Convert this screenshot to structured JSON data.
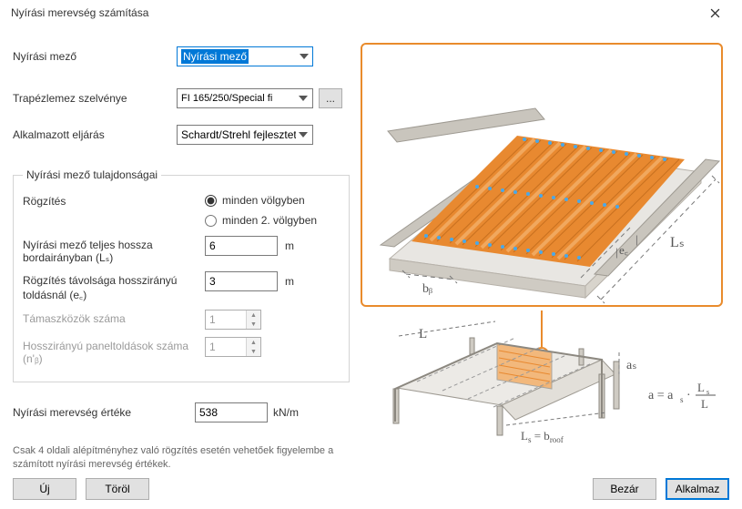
{
  "window": {
    "title": "Nyírási merevség számítása"
  },
  "fields": {
    "shear_field_label": "Nyírási mező",
    "shear_field_value": "Nyírási mező",
    "profile_label": "Trapézlemez szelvénye",
    "profile_value": "FI 165/250/Special fi",
    "ellipsis": "...",
    "method_label": "Alkalmazott eljárás",
    "method_value": "Schardt/Strehl fejlesztett"
  },
  "group": {
    "legend": "Nyírási mező tulajdonságai",
    "fixing_label": "Rögzítés",
    "fixing_opt1": "minden völgyben",
    "fixing_opt2": "minden 2. völgyben",
    "length_label": "Nyírási mező teljes hossza bordairányban (Lₛ)",
    "length_value": "6",
    "length_unit": "m",
    "spacing_label": "Rögzítés távolsága hosszirányú toldásnál (e꜀)",
    "spacing_value": "3",
    "spacing_unit": "m",
    "supports_label": "Támaszközök száma",
    "supports_value": "1",
    "panels_label": "Hosszirányú paneltoldások száma (n'ᵦ)",
    "panels_value": "1"
  },
  "result": {
    "label": "Nyírási merevség értéke",
    "value": "538",
    "unit": "kN/m"
  },
  "note": "Csak 4 oldali alépítményhez való rögzítés esetén vehetőek figyelembe a számított nyírási merevség értékek.",
  "diagram": {
    "ls": "Lₛ",
    "el": "e꜀",
    "bb": "bᵦ",
    "L": "L",
    "as": "aₛ",
    "eq_bottom": "Lₛ = b_roof",
    "eq_right": "a = aₛ · Lₛ / L"
  },
  "footer": {
    "new": "Új",
    "delete": "Töröl",
    "close": "Bezár",
    "apply": "Alkalmaz"
  }
}
